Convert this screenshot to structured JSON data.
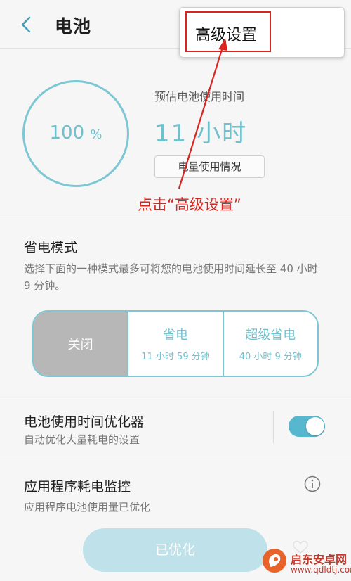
{
  "header": {
    "title": "电池",
    "back_icon": "chevron-left-icon"
  },
  "menu": {
    "items": [
      "高级设置"
    ]
  },
  "battery": {
    "percent": "100",
    "percent_unit": "%",
    "estimate_label": "预估电池使用时间",
    "estimate_value": "11 小时",
    "usage_button": "电量使用情况"
  },
  "annotation": {
    "text": "点击“高级设置”",
    "color": "#d9241f"
  },
  "power_mode": {
    "title": "省电模式",
    "description": "选择下面的一种模式最多可将您的电池使用时间延长至 40 小时 9 分钟。",
    "options": [
      {
        "label": "关闭",
        "detail": "",
        "selected": true
      },
      {
        "label": "省电",
        "detail": "11 小时 59 分钟",
        "selected": false
      },
      {
        "label": "超级省电",
        "detail": "40 小时 9 分钟",
        "selected": false
      }
    ]
  },
  "optimizer": {
    "title": "电池使用时间优化器",
    "description": "自动优化大量耗电的设置",
    "toggle_on": true
  },
  "app_monitor": {
    "title": "应用程序耗电监控",
    "description": "应用程序电池使用量已优化",
    "button": "已优化",
    "info_icon": "info-icon"
  },
  "watermark": {
    "name": "启东安卓网",
    "url": "www.qdldtj.com"
  },
  "colors": {
    "accent": "#6fc1cd",
    "annotation": "#d9241f",
    "toggle": "#56b7ce"
  }
}
